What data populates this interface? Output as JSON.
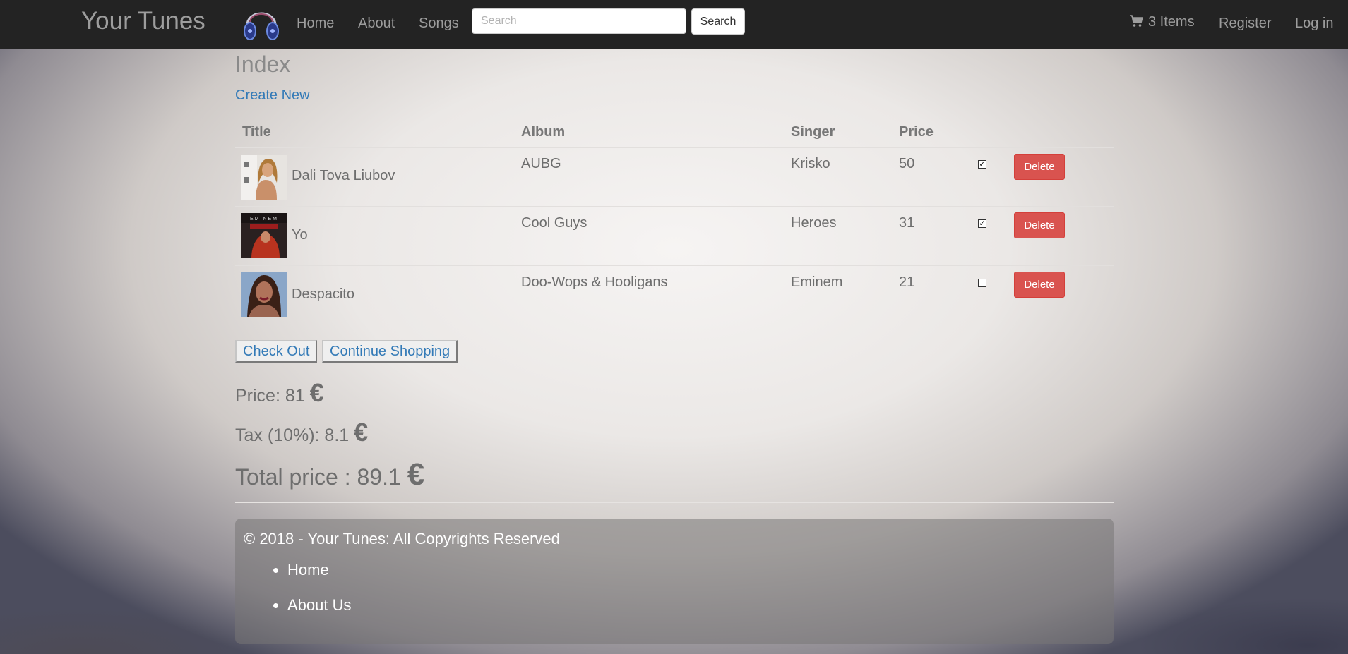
{
  "navbar": {
    "brand": "Your Tunes",
    "links": [
      "Home",
      "About",
      "Songs"
    ],
    "search_placeholder": "Search",
    "search_button": "Search",
    "cart_label": "3 Items",
    "register": "Register",
    "login": "Log in"
  },
  "page": {
    "heading": "Index",
    "create_new": "Create New"
  },
  "table": {
    "columns": [
      "Title",
      "Album",
      "Singer",
      "Price"
    ],
    "rows": [
      {
        "title": "Dali Tova Liubov",
        "album": "AUBG",
        "singer": "Krisko",
        "price": "50",
        "checked": true,
        "delete_label": "Delete"
      },
      {
        "title": "Yo",
        "album": "Cool Guys",
        "singer": "Heroes",
        "price": "31",
        "checked": true,
        "delete_label": "Delete"
      },
      {
        "title": "Despacito",
        "album": "Doo-Wops & Hooligans",
        "singer": "Eminem",
        "price": "21",
        "checked": false,
        "delete_label": "Delete"
      }
    ]
  },
  "actions": {
    "checkout": "Check Out",
    "continue": "Continue Shopping"
  },
  "summary": {
    "price_label": "Price: 81",
    "tax_label": "Tax (10%): 8.1",
    "total_label": "Total price : 89.1",
    "currency": "€"
  },
  "footer": {
    "copyright": "© 2018 - Your Tunes: All Copyrights Reserved",
    "links": [
      "Home",
      "About Us"
    ]
  },
  "colors": {
    "navbar": "#232323",
    "link": "#337ab7",
    "danger": "#d9534f"
  }
}
